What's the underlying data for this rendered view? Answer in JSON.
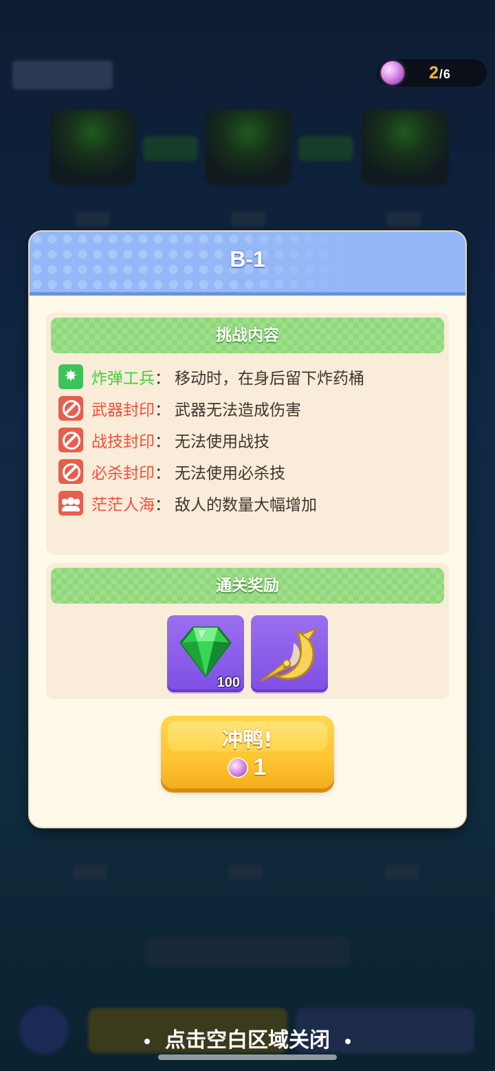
{
  "counter": {
    "current": "2",
    "total": "/6",
    "icon": "candy-icon"
  },
  "modal": {
    "title": "B-1",
    "challenge": {
      "header": "挑战内容",
      "rules": [
        {
          "icon": "bomber-icon",
          "name": "炸弹工兵",
          "sep": "：",
          "desc": "移动时，在身后留下炸药桶",
          "name_color": "#3fcf3a"
        },
        {
          "icon": "seal-icon",
          "name": "武器封印",
          "sep": "：",
          "desc": "武器无法造成伤害",
          "name_color": "#f0503c"
        },
        {
          "icon": "seal-icon",
          "name": "战技封印",
          "sep": "：",
          "desc": "无法使用战技",
          "name_color": "#f0503c"
        },
        {
          "icon": "seal-icon",
          "name": "必杀封印",
          "sep": "：",
          "desc": "无法使用必杀技",
          "name_color": "#f0503c"
        },
        {
          "icon": "crowd-icon",
          "name": "茫茫人海",
          "sep": "：",
          "desc": "敌人的数量大幅增加",
          "name_color": "#f0503c"
        }
      ]
    },
    "reward": {
      "header": "通关奖励",
      "items": [
        {
          "icon": "emerald-gem-icon",
          "quantity": "100"
        },
        {
          "icon": "golden-crescent-icon",
          "quantity": ""
        }
      ]
    },
    "go_button": {
      "label": "冲鸭!",
      "cost": "1",
      "cost_icon": "candy-icon"
    }
  },
  "close_hint": "点击空白区域关闭",
  "colors": {
    "header_blue": "#93b7f7",
    "section_green": "#8fd87a",
    "button_yellow": "#ffc533",
    "reward_purple": "#8a5cea"
  }
}
